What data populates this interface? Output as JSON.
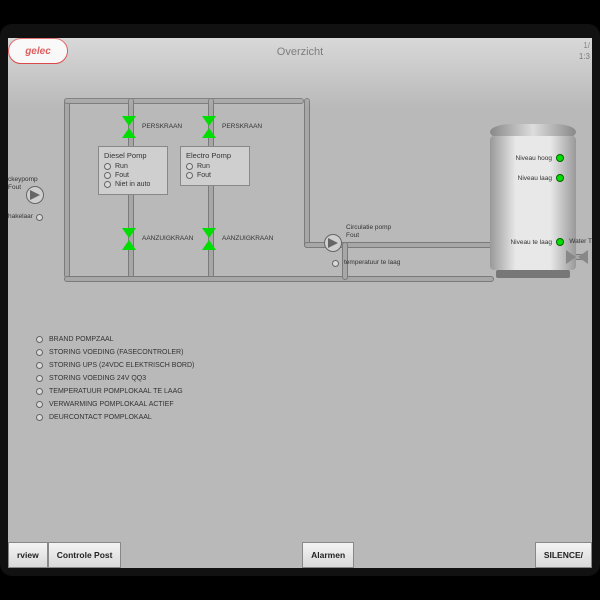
{
  "header": {
    "logo": "gelec",
    "title": "Overzicht",
    "date": "1/",
    "time": "1:3"
  },
  "valves": {
    "perskraan1": "PERSKRAAN",
    "perskraan2": "PERSKRAAN",
    "aanzuig1": "AANZUIGKRAAN",
    "aanzuig2": "AANZUIGKRAAN"
  },
  "pumps": {
    "jockey": {
      "name": "ckeypomp",
      "fault": "Fout",
      "switch": "hakelaar"
    },
    "circ": {
      "name": "Circulatie pomp",
      "fault": "Fout",
      "temp": "temperatuur te laag"
    }
  },
  "cards": {
    "diesel": {
      "title": "Diesel Pomp",
      "run": "Run",
      "fault": "Fout",
      "notauto": "Niet in auto"
    },
    "electro": {
      "title": "Electro Pomp",
      "run": "Run",
      "fault": "Fout"
    }
  },
  "tank": {
    "high": "Niveau hoog",
    "low": "Niveau laag",
    "toolow": "Niveau te laag",
    "water": "Water T"
  },
  "alarms": [
    "BRAND POMPZAAL",
    "STORING VOEDING (FASECONTROLER)",
    "STORING UPS (24VDC ELEKTRISCH BORD)",
    "STORING VOEDING 24V QQ3",
    "TEMPERATUUR POMPLOKAAL TE LAAG",
    "VERWARMING POMPLOKAAL ACTIEF",
    "DEURCONTACT POMPLOKAAL"
  ],
  "buttons": {
    "overview": "rview",
    "controle": "Controle Post",
    "alarmen": "Alarmen",
    "silence": "SILENCE/"
  }
}
